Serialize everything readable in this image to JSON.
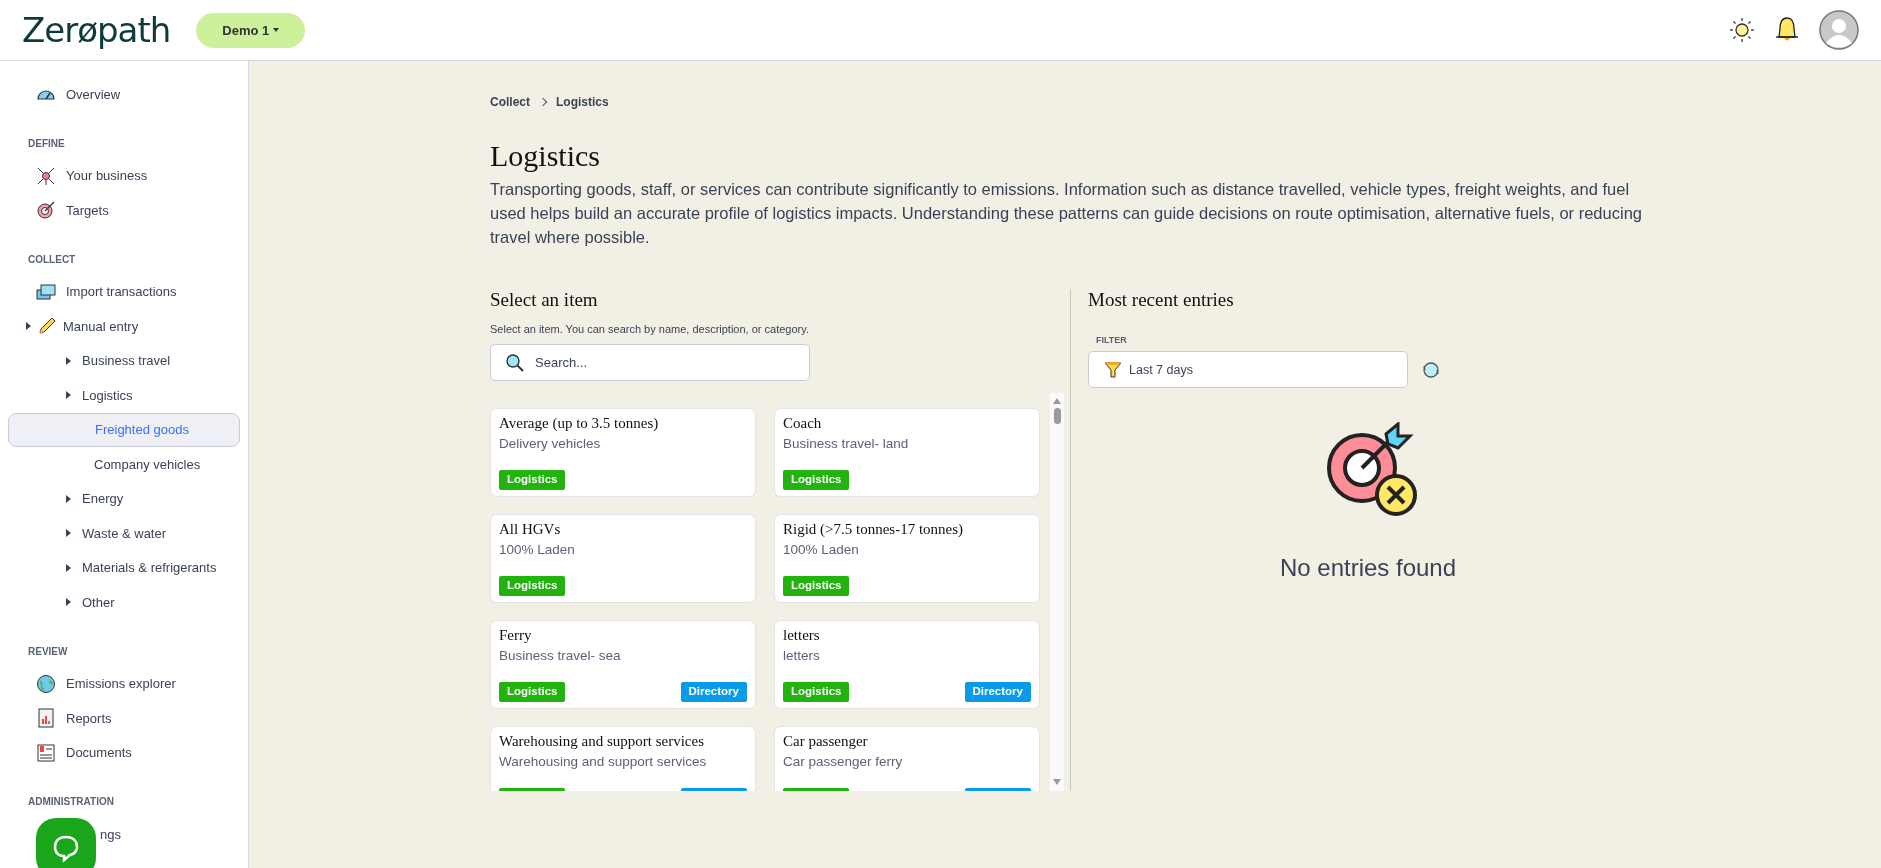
{
  "header": {
    "logo": "Zerøpath",
    "workspace_button": "Demo 1"
  },
  "sidebar": {
    "sections": [
      {
        "items": [
          {
            "label": "Overview",
            "kind": "link",
            "selected": false
          }
        ]
      },
      {
        "heading": "DEFINE",
        "items": [
          {
            "label": "Your business",
            "kind": "link",
            "selected": false
          },
          {
            "label": "Targets",
            "kind": "link",
            "selected": false
          }
        ]
      },
      {
        "heading": "COLLECT",
        "items": [
          {
            "label": "Import transactions",
            "kind": "link",
            "selected": false
          },
          {
            "label": "Manual entry",
            "kind": "group",
            "selected": false,
            "children": [
              {
                "label": "Business travel",
                "kind": "group",
                "selected": false
              },
              {
                "label": "Logistics",
                "kind": "group",
                "selected": false,
                "children": [
                  {
                    "label": "Freighted goods",
                    "kind": "link",
                    "selected": true
                  },
                  {
                    "label": "Company vehicles",
                    "kind": "link",
                    "selected": false
                  }
                ]
              },
              {
                "label": "Energy",
                "kind": "group",
                "selected": false
              },
              {
                "label": "Waste & water",
                "kind": "group",
                "selected": false
              },
              {
                "label": "Materials & refrigerants",
                "kind": "group",
                "selected": false
              },
              {
                "label": "Other",
                "kind": "group",
                "selected": false
              }
            ]
          }
        ]
      },
      {
        "heading": "REVIEW",
        "items": [
          {
            "label": "Emissions explorer",
            "kind": "link",
            "selected": false
          },
          {
            "label": "Reports",
            "kind": "link",
            "selected": false
          },
          {
            "label": "Documents",
            "kind": "link",
            "selected": false
          }
        ]
      },
      {
        "heading": "ADMINISTRATION",
        "items": [
          {
            "label": "ngs",
            "kind": "link",
            "selected": false
          }
        ]
      }
    ]
  },
  "breadcrumb": [
    "Collect",
    "Logistics"
  ],
  "page": {
    "title": "Logistics",
    "description": "Transporting goods, staff, or services can contribute significantly to emissions. Information such as distance travelled, vehicle types, freight weights, and fuel used helps build an accurate profile of logistics impacts. Understanding these patterns can guide decisions on route optimisation, alternative fuels, or reducing travel where possible."
  },
  "select_panel": {
    "title": "Select an item",
    "hint": "Select an item. You can search by name, description, or category.",
    "search": {
      "placeholder": "Search..."
    },
    "cards": [
      {
        "title": "Average (up to 3.5 tonnes)",
        "subtitle": "Delivery vehicles",
        "tags": [
          {
            "label": "Logistics",
            "color": "#22b30f"
          }
        ]
      },
      {
        "title": "Coach",
        "subtitle": "Business travel- land",
        "tags": [
          {
            "label": "Logistics",
            "color": "#22b30f"
          }
        ]
      },
      {
        "title": "All HGVs",
        "subtitle": "100% Laden",
        "tags": [
          {
            "label": "Logistics",
            "color": "#22b30f"
          }
        ]
      },
      {
        "title": "Rigid (>7.5 tonnes-17 tonnes)",
        "subtitle": "100% Laden",
        "tags": [
          {
            "label": "Logistics",
            "color": "#22b30f"
          }
        ]
      },
      {
        "title": "Ferry",
        "subtitle": "Business travel- sea",
        "tags": [
          {
            "label": "Logistics",
            "color": "#22b30f"
          },
          {
            "label": "Directory",
            "color": "#0a9be8"
          }
        ]
      },
      {
        "title": "letters",
        "subtitle": "letters",
        "tags": [
          {
            "label": "Logistics",
            "color": "#22b30f"
          },
          {
            "label": "Directory",
            "color": "#0a9be8"
          }
        ]
      },
      {
        "title": "Warehousing and support services",
        "subtitle": "Warehousing and support services",
        "tags": [
          {
            "color": "#22b30f"
          },
          {
            "color": "#0a9be8"
          }
        ]
      },
      {
        "title": "Car passenger",
        "subtitle": "Car passenger ferry",
        "tags": [
          {
            "color": "#22b30f"
          },
          {
            "color": "#0a9be8"
          }
        ]
      }
    ]
  },
  "recent_panel": {
    "title": "Most recent entries",
    "filter_label": "FILTER",
    "filter_value": "Last 7 days",
    "empty_message": "No entries found"
  }
}
